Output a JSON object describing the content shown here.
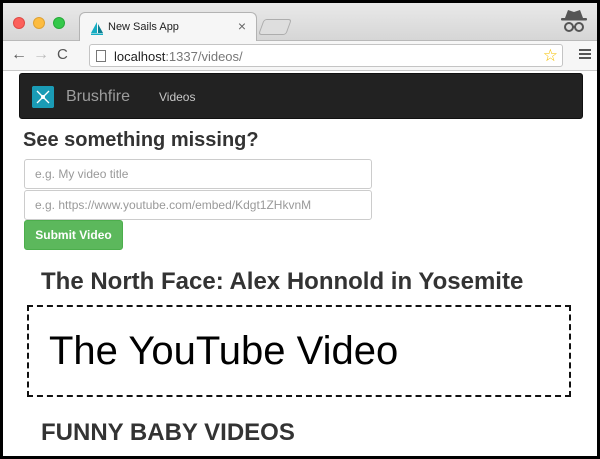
{
  "browser": {
    "tab_title": "New Sails App",
    "tab_close": "×",
    "url_host": "localhost",
    "url_rest": ":1337/videos/",
    "back_glyph": "←",
    "forward_glyph": "→",
    "reload_glyph": "C",
    "star_glyph": "☆"
  },
  "navbar": {
    "brand": "Brushfire",
    "links": [
      "Videos"
    ]
  },
  "form": {
    "heading": "See something missing?",
    "title_placeholder": "e.g. My video title",
    "src_placeholder": "e.g. https://www.youtube.com/embed/Kdgt1ZHkvnM",
    "submit_label": "Submit Video"
  },
  "videos": [
    {
      "title": "The North Face: Alex Honnold in Yosemite",
      "placeholder": "The YouTube Video"
    },
    {
      "title": "FUNNY BABY VIDEOS"
    }
  ],
  "colors": {
    "navbar_bg": "#222222",
    "submit_bg": "#5cb85c",
    "logo_bg": "#1a9bb5"
  },
  "icons": [
    "sails-tab-icon",
    "incognito-icon",
    "page-icon",
    "star-icon",
    "menu-icon",
    "brushfire-logo-icon"
  ]
}
